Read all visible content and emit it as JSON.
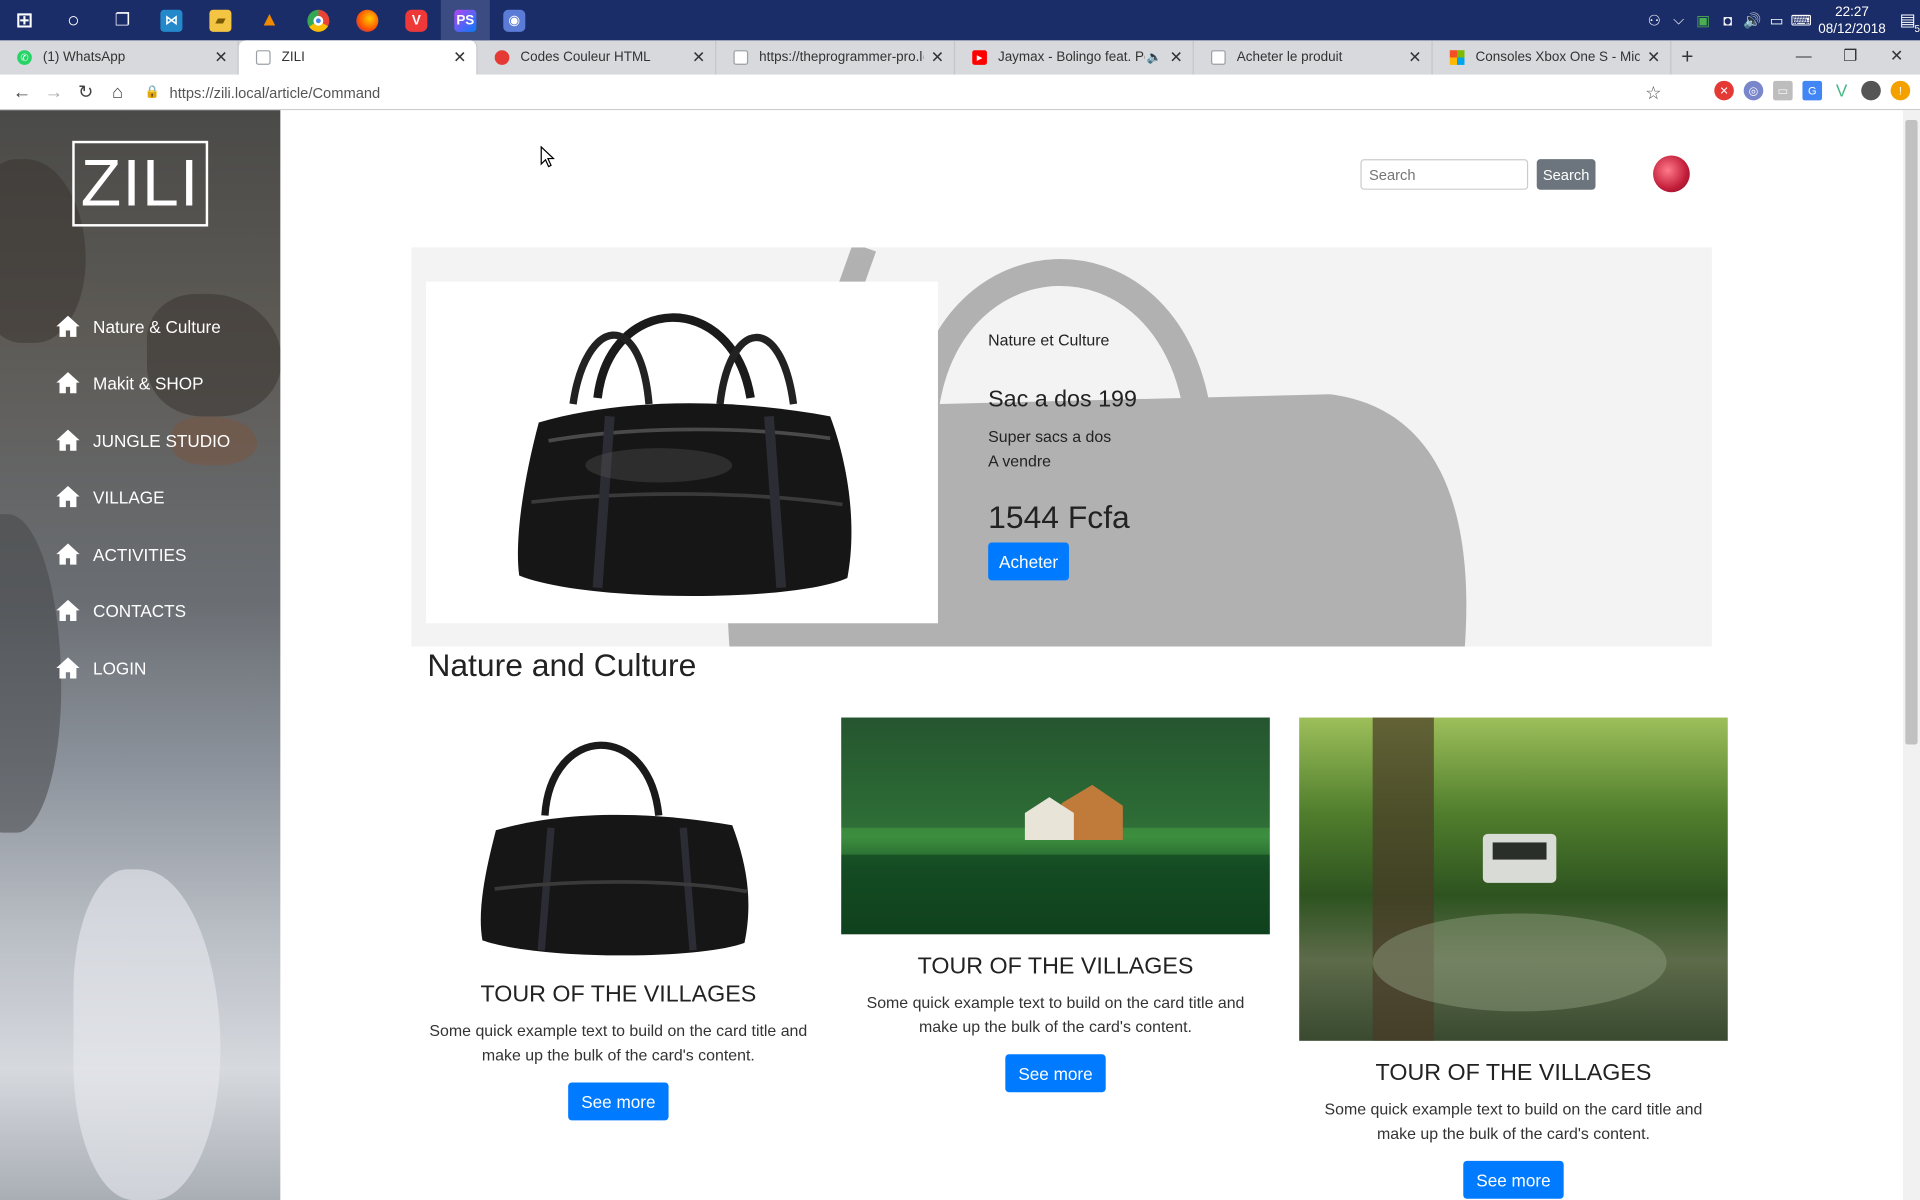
{
  "taskbar": {
    "apps": [
      {
        "name": "start",
        "glyph": "⊞",
        "color": "#ffffff"
      },
      {
        "name": "cortana",
        "glyph": "○",
        "color": "#ffffff"
      },
      {
        "name": "task-view",
        "glyph": "❐",
        "color": "#ffffff"
      },
      {
        "name": "vscode",
        "glyph": "⋈",
        "color": "#2489ca"
      },
      {
        "name": "explorer",
        "glyph": "▰",
        "color": "#f4c542"
      },
      {
        "name": "vlc",
        "glyph": "▲",
        "color": "#f08a00"
      },
      {
        "name": "chrome",
        "glyph": "●",
        "color": "#4caf50"
      },
      {
        "name": "firefox",
        "glyph": "●",
        "color": "#ff7b00"
      },
      {
        "name": "vivaldi",
        "glyph": "V",
        "color": "#ef3939"
      },
      {
        "name": "phpstorm",
        "glyph": "PS",
        "color": "#8a3ad6"
      },
      {
        "name": "recorder",
        "glyph": "◉",
        "color": "#5a7bd6"
      }
    ],
    "clock_time": "22:27",
    "clock_date": "08/12/2018",
    "notification_count": "5"
  },
  "tabs": [
    {
      "title": "(1) WhatsApp",
      "fav_color": "#25d366",
      "fav_glyph": "✆"
    },
    {
      "title": "ZILI",
      "fav_color": "#9aa0a6",
      "fav_glyph": "▯",
      "active": true
    },
    {
      "title": "Codes Couleur HTML",
      "fav_color": "#e53935",
      "fav_glyph": "◆"
    },
    {
      "title": "https://theprogrammer-pro.local",
      "fav_color": "#bdbdbd",
      "fav_glyph": "▯"
    },
    {
      "title": "Jaymax - Bolingo feat. Pemb",
      "fav_color": "#ff0000",
      "fav_glyph": "▶",
      "audio": "🔈"
    },
    {
      "title": "Acheter le produit",
      "fav_color": "#bdbdbd",
      "fav_glyph": "▯"
    },
    {
      "title": "Consoles Xbox One S - Microsoft",
      "fav_color": "#f25022",
      "fav_glyph": "▦"
    }
  ],
  "address": {
    "url": "https://zili.local/article/Command"
  },
  "sidebar": {
    "logo": "ZILI",
    "items": [
      {
        "label": "Nature & Culture"
      },
      {
        "label": "Makit & SHOP"
      },
      {
        "label": "JUNGLE STUDIO"
      },
      {
        "label": "VILLAGE"
      },
      {
        "label": "ACTIVITIES"
      },
      {
        "label": "CONTACTS"
      },
      {
        "label": "LOGIN"
      }
    ]
  },
  "header": {
    "search_placeholder": "Search",
    "search_button": "Search"
  },
  "hero": {
    "category": "Nature et Culture",
    "title": "Sac a dos 199",
    "desc_line1": "Super sacs a dos",
    "desc_line2": "A vendre",
    "price": "1544 Fcfa",
    "buy_label": "Acheter"
  },
  "section": {
    "title": "Nature and Culture",
    "cards": [
      {
        "title": "TOUR OF THE VILLAGES",
        "text": "Some quick example text to build on the card title and make up the bulk of the card's content.",
        "button": "See more"
      },
      {
        "title": "TOUR OF THE VILLAGES",
        "text": "Some quick example text to build on the card title and make up the bulk of the card's content.",
        "button": "See more"
      },
      {
        "title": "TOUR OF THE VILLAGES",
        "text": "Some quick example text to build on the card title and make up the bulk of the card's content.",
        "button": "See more"
      }
    ]
  }
}
